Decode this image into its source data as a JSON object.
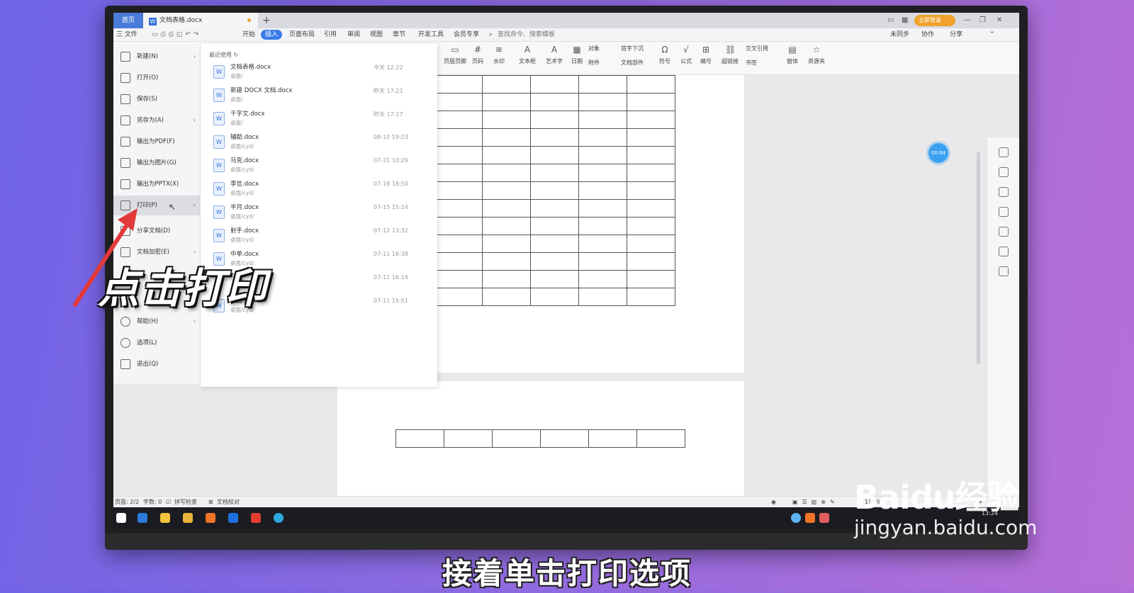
{
  "tabs": {
    "home": "首页",
    "doc_name": "文档表格.docx"
  },
  "title_bar": {
    "login": "立即登录"
  },
  "menu": {
    "file": "三 文件",
    "items": [
      "开始",
      "插入",
      "页面布局",
      "引用",
      "审阅",
      "视图",
      "章节",
      "开发工具",
      "会员专享"
    ],
    "active": "插入",
    "search": "查找命令、搜索模板",
    "sync": "未同步",
    "collab": "协作",
    "share": "分享"
  },
  "ribbon": {
    "buttons": [
      "页眉页脚",
      "页码",
      "水印",
      "文本框",
      "艺术字",
      "日期",
      "对象",
      "附件",
      "首字下沉",
      "文档部件",
      "符号",
      "公式",
      "编号",
      "超链接",
      "交叉引用",
      "书签",
      "窗体",
      "资源夹"
    ]
  },
  "file_menu": {
    "items": [
      {
        "label": "新建(N)",
        "arrow": "›"
      },
      {
        "label": "打开(O)",
        "arrow": ""
      },
      {
        "label": "保存(S)",
        "arrow": ""
      },
      {
        "label": "另存为(A)",
        "arrow": "›"
      },
      {
        "label": "输出为PDF(F)",
        "arrow": ""
      },
      {
        "label": "输出为图片(G)",
        "arrow": ""
      },
      {
        "label": "输出为PPTX(X)",
        "arrow": ""
      },
      {
        "label": "打印(P)",
        "arrow": "›"
      },
      {
        "label": "分享文档(D)",
        "arrow": ""
      },
      {
        "label": "文档加密(E)",
        "arrow": "›"
      },
      {
        "label": "帮助(H)",
        "arrow": "›"
      },
      {
        "label": "选项(L)",
        "arrow": ""
      },
      {
        "label": "退出(Q)",
        "arrow": ""
      }
    ],
    "selected": "打印(P)"
  },
  "recent": {
    "title": "最近使用",
    "files": [
      {
        "name": "文档表格.docx",
        "path": "桌面/",
        "time": "今天 12:22"
      },
      {
        "name": "新建 DOCX 文档.docx",
        "path": "桌面/",
        "time": "昨天 17:21"
      },
      {
        "name": "千字文.docx",
        "path": "桌面/",
        "time": "昨天 17:17"
      },
      {
        "name": "辅助.docx",
        "path": "桌面/cyd/",
        "time": "08-10 19:23"
      },
      {
        "name": "马克.docx",
        "path": "桌面/cyd/",
        "time": "07-21 10:29"
      },
      {
        "name": "李信.docx",
        "path": "桌面/cyd/",
        "time": "07-18 18:50"
      },
      {
        "name": "半月.docx",
        "path": "桌面/cyd/",
        "time": "07-15 15:24"
      },
      {
        "name": "射手.docx",
        "path": "桌面/cyd/",
        "time": "07-12 13:32"
      },
      {
        "name": "中单.docx",
        "path": "桌面/cyd/",
        "time": "07-11 16:38"
      },
      {
        "name": "",
        "path": "",
        "time": "07-11 16:14"
      },
      {
        "name": "…边.docx",
        "path": "桌面/cyd/",
        "time": "07-11 15:51"
      }
    ]
  },
  "status_bar": {
    "page": "页面: 2/2",
    "words": "字数: 0",
    "spell": "拼写检查",
    "proof": "文档校对",
    "zoom": "110%"
  },
  "timer": "00:04",
  "taskbar": {
    "time": "13:24"
  },
  "annotation": {
    "callout": "点击打印",
    "subtitle": "接着单击打印选项"
  },
  "watermark": {
    "logo": "Baidu经验",
    "url": "jingyan.baidu.com"
  },
  "colors": {
    "accent": "#3a7bea",
    "arrow": "#e23a3a",
    "login": "#f0a22c"
  }
}
